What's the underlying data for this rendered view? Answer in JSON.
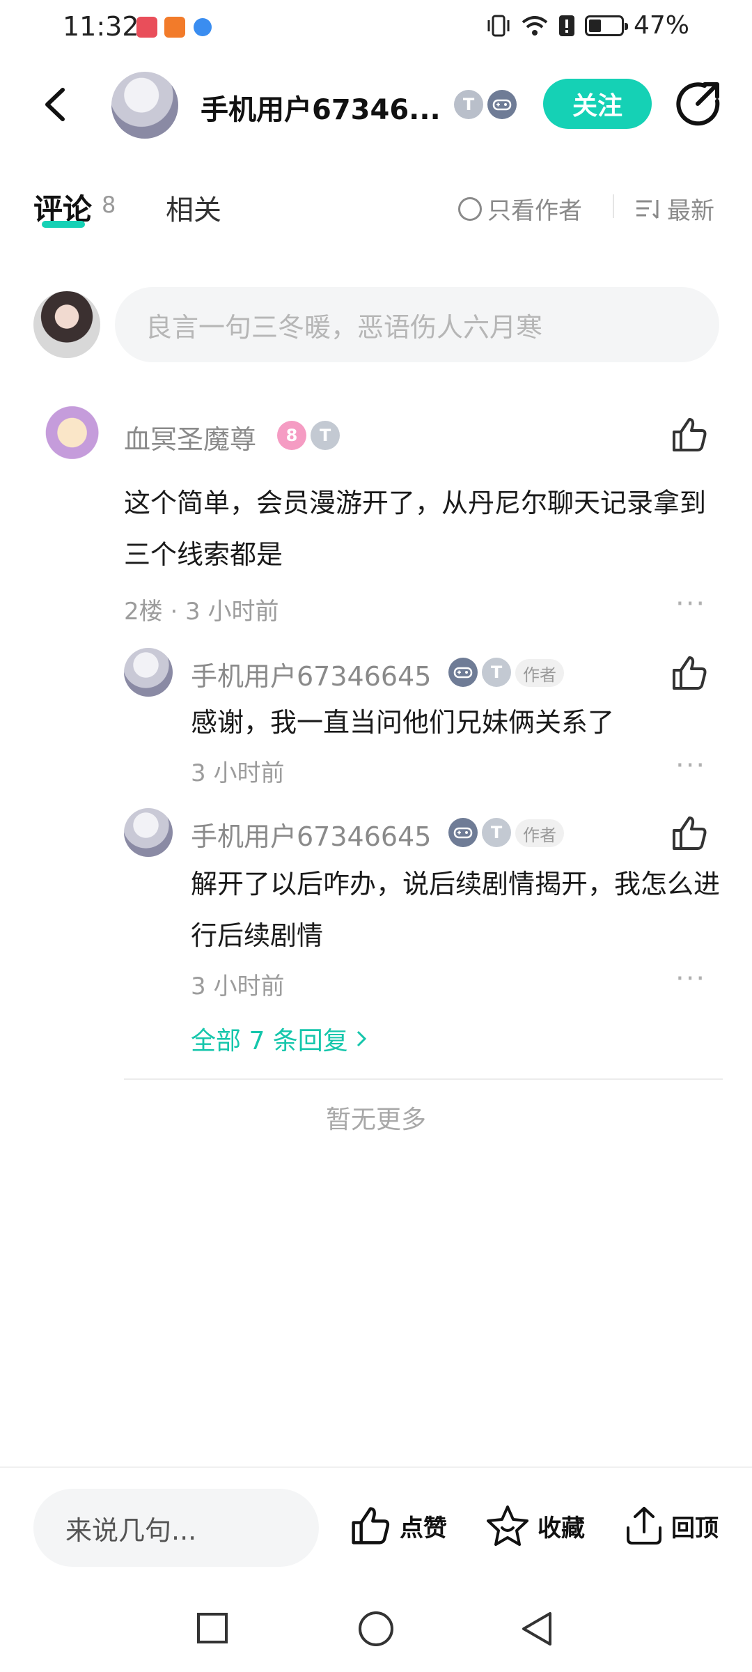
{
  "status_bar": {
    "time": "11:32",
    "battery": "47%",
    "battery_level": 0.47
  },
  "header": {
    "username": "手机用户67346...",
    "follow_label": "关注",
    "badge_1": "T",
    "badge_1_sub": "1"
  },
  "tabs": {
    "comments_label": "评论",
    "comments_count": "8",
    "related_label": "相关",
    "author_only_label": "只看作者",
    "sort_label": "最新"
  },
  "composer": {
    "placeholder": "良言一句三冬暖，恶语伤人六月寒"
  },
  "comment": {
    "username": "血冥圣魔尊",
    "level_badge": "8",
    "t_badge": "T",
    "t_badge_sub": "2",
    "text": "这个简单，会员漫游开了，从丹尼尔聊天记录拿到三个线索都是",
    "meta": "2楼 · 3 小时前",
    "more": "···"
  },
  "replies": [
    {
      "username": "手机用户67346645",
      "tag": "作者",
      "t_badge": "T",
      "text": "感谢，我一直当问他们兄妹俩关系了",
      "time": "3 小时前",
      "more": "···"
    },
    {
      "username": "手机用户67346645",
      "tag": "作者",
      "t_badge": "T",
      "text": "解开了以后咋办，说后续剧情揭开，我怎么进行后续剧情",
      "time": "3 小时前",
      "more": "···"
    }
  ],
  "view_all_replies": "全部 7 条回复",
  "no_more": "暂无更多",
  "bottom_bar": {
    "input_placeholder": "来说几句...",
    "like_label": "点赞",
    "favorite_label": "收藏",
    "top_label": "回顶"
  },
  "colors": {
    "accent": "#15d1b5",
    "link": "#15c6ab",
    "muted": "#8a8a8a"
  }
}
